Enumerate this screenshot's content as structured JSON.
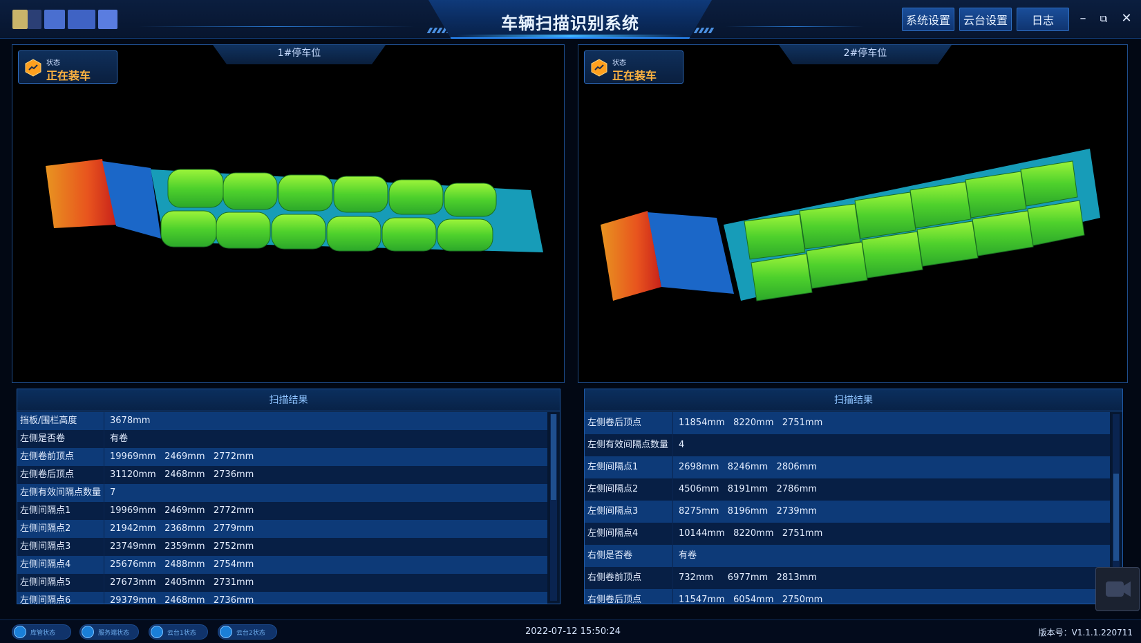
{
  "app": {
    "title": "车辆扫描识别系统"
  },
  "toolbar": {
    "system_settings": "系统设置",
    "ptz_settings": "云台设置",
    "log": "日志",
    "minimize": "–",
    "restore": "⧉",
    "close": "✕"
  },
  "parking": [
    {
      "header": "1#停车位",
      "status_label": "状态",
      "status_value": "正在装车",
      "result_title": "扫描结果",
      "rows": [
        {
          "k": "挡板/围栏高度",
          "v": "3678mm"
        },
        {
          "k": "左侧是否卷",
          "v": "有卷"
        },
        {
          "k": "左侧卷前顶点",
          "v": "19969mm   2469mm   2772mm"
        },
        {
          "k": "左侧卷后顶点",
          "v": "31120mm   2468mm   2736mm"
        },
        {
          "k": "左侧有效间隔点数量",
          "v": "7"
        },
        {
          "k": "左侧间隔点1",
          "v": "19969mm   2469mm   2772mm"
        },
        {
          "k": "左侧间隔点2",
          "v": "21942mm   2368mm   2779mm"
        },
        {
          "k": "左侧间隔点3",
          "v": "23749mm   2359mm   2752mm"
        },
        {
          "k": "左侧间隔点4",
          "v": "25676mm   2488mm   2754mm"
        },
        {
          "k": "左侧间隔点5",
          "v": "27673mm   2405mm   2731mm"
        },
        {
          "k": "左侧间隔点6",
          "v": "29379mm   2468mm   2736mm"
        }
      ]
    },
    {
      "header": "2#停车位",
      "status_label": "状态",
      "status_value": "正在装车",
      "result_title": "扫描结果",
      "rows": [
        {
          "k": "左侧卷后顶点",
          "v": "11854mm   8220mm   2751mm"
        },
        {
          "k": "左侧有效间隔点数量",
          "v": "4"
        },
        {
          "k": "左侧间隔点1",
          "v": "2698mm   8246mm   2806mm"
        },
        {
          "k": "左侧间隔点2",
          "v": "4506mm   8191mm   2786mm"
        },
        {
          "k": "左侧间隔点3",
          "v": "8275mm   8196mm   2739mm"
        },
        {
          "k": "左侧间隔点4",
          "v": "10144mm   8220mm   2751mm"
        },
        {
          "k": "右侧是否卷",
          "v": "有卷"
        },
        {
          "k": "右侧卷前顶点",
          "v": "732mm     6977mm   2813mm"
        },
        {
          "k": "右侧卷后顶点",
          "v": "11547mm   6054mm   2750mm"
        }
      ]
    }
  ],
  "statusbar": {
    "pills": [
      "库管状态",
      "服务端状态",
      "云台1状态",
      "云台2状态"
    ],
    "datetime": "2022-07-12 15:50:24",
    "version": "版本号：V1.1.1.220711"
  },
  "colors": {
    "accent": "#2a8cff",
    "status_orange": "#ffb340",
    "panel_bg": "#061731"
  }
}
